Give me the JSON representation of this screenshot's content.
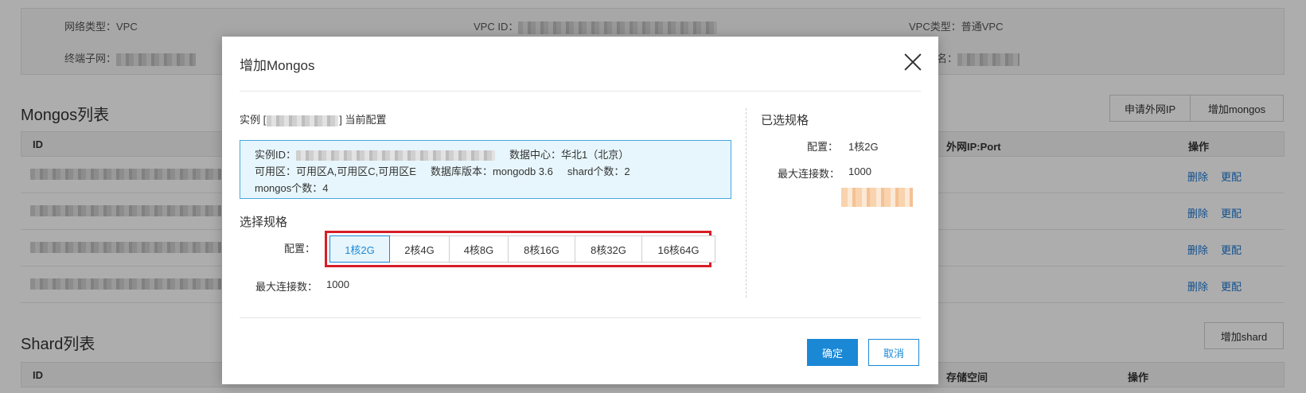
{
  "background": {
    "info": {
      "network_type": "网络类型：VPC",
      "vpc_id_label": "VPC ID：",
      "vpc_type": "VPC类型：普通VPC",
      "subnet_label": "终端子网：",
      "name_label_partial": "名："
    },
    "mongos_section": {
      "title": "Mongos列表",
      "apply_public_ip_button": "申请外网IP",
      "add_mongos_button": "增加mongos",
      "columns": {
        "id": "ID",
        "public_ip_port": "外网IP:Port",
        "actions": "操作"
      },
      "rows": [
        {
          "delete": "删除",
          "change": "更配"
        },
        {
          "delete": "删除",
          "change": "更配"
        },
        {
          "delete": "删除",
          "change": "更配"
        },
        {
          "delete": "删除",
          "change": "更配"
        }
      ]
    },
    "shard_section": {
      "title": "Shard列表",
      "add_shard_button": "增加shard",
      "columns": {
        "id": "ID",
        "storage": "存储空间",
        "actions": "操作"
      }
    }
  },
  "modal": {
    "title": "增加Mongos",
    "instance_prefix": "实例 [",
    "instance_suffix": "] 当前配置",
    "info_box": {
      "instance_id_label": "实例ID：",
      "datacenter": "数据中心：华北1（北京）",
      "zones": "可用区：可用区A,可用区C,可用区E",
      "db_version": "数据库版本：mongodb 3.6",
      "shard_count": "shard个数：2",
      "mongos_count": "mongos个数：4"
    },
    "spec_section_title": "选择规格",
    "config_label": "配置：",
    "spec_options": [
      "1核2G",
      "2核4G",
      "4核8G",
      "8核16G",
      "8核32G",
      "16核64G"
    ],
    "selected_option": "1核2G",
    "max_connections_label": "最大连接数：",
    "max_connections_value": "1000",
    "selected_spec": {
      "title": "已选规格",
      "config_label": "配置：",
      "config_value": "1核2G",
      "max_connections_label": "最大连接数：",
      "max_connections_value": "1000"
    },
    "ok_button": "确定",
    "cancel_button": "取消"
  },
  "colors": {
    "primary": "#1b88d6",
    "highlight_border": "#d71e27",
    "info_box_bg": "#e7f6fc",
    "link": "#1b77d2"
  }
}
